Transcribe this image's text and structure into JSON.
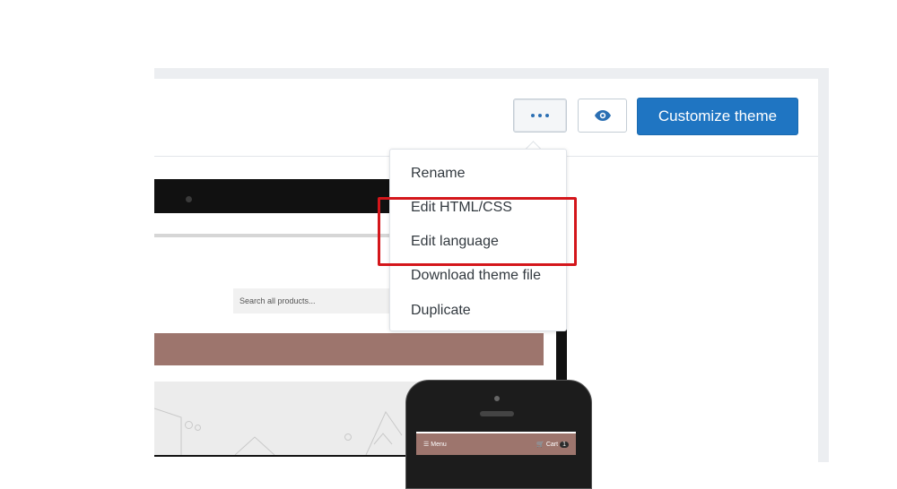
{
  "toolbar": {
    "more_icon": "horizontal-ellipsis-icon",
    "preview_icon": "eye-icon",
    "customize_label": "Customize theme",
    "accent_color": "#1f75c2"
  },
  "menu": {
    "items": [
      "Rename",
      "Edit HTML/CSS",
      "Edit language",
      "Download theme file",
      "Duplicate"
    ],
    "highlight_color": "#d4161b"
  },
  "preview": {
    "search_placeholder": "Search all products...",
    "banner_color": "#9d756d",
    "phone_menu_label": "Menu",
    "phone_cart_label": "Cart",
    "phone_cart_count": "1"
  }
}
